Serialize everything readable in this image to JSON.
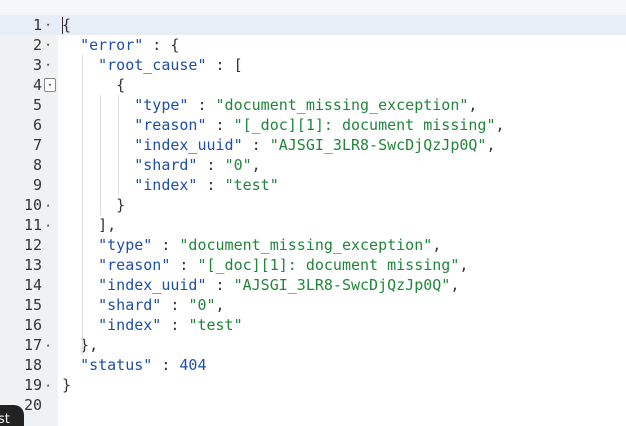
{
  "editor": {
    "lines": [
      {
        "n": "1",
        "fold": "▾",
        "t": [
          [
            "p",
            "{"
          ]
        ]
      },
      {
        "n": "2",
        "fold": "▾",
        "t": [
          [
            "p",
            "  "
          ],
          [
            "k",
            "\"error\""
          ],
          [
            "p",
            " : {"
          ]
        ]
      },
      {
        "n": "3",
        "fold": "▾",
        "t": [
          [
            "p",
            "    "
          ],
          [
            "k",
            "\"root_cause\""
          ],
          [
            "p",
            " : ["
          ]
        ]
      },
      {
        "n": "4",
        "fold": "▾",
        "boxed": true,
        "t": [
          [
            "p",
            "      {"
          ]
        ]
      },
      {
        "n": "5",
        "fold": "",
        "t": [
          [
            "p",
            "        "
          ],
          [
            "k",
            "\"type\""
          ],
          [
            "p",
            " : "
          ],
          [
            "s",
            "\"document_missing_exception\""
          ],
          [
            "p",
            ","
          ]
        ]
      },
      {
        "n": "6",
        "fold": "",
        "t": [
          [
            "p",
            "        "
          ],
          [
            "k",
            "\"reason\""
          ],
          [
            "p",
            " : "
          ],
          [
            "s",
            "\"[_doc][1]: document missing\""
          ],
          [
            "p",
            ","
          ]
        ]
      },
      {
        "n": "7",
        "fold": "",
        "t": [
          [
            "p",
            "        "
          ],
          [
            "k",
            "\"index_uuid\""
          ],
          [
            "p",
            " : "
          ],
          [
            "s",
            "\"AJSGI_3LR8-SwcDjQzJp0Q\""
          ],
          [
            "p",
            ","
          ]
        ]
      },
      {
        "n": "8",
        "fold": "",
        "t": [
          [
            "p",
            "        "
          ],
          [
            "k",
            "\"shard\""
          ],
          [
            "p",
            " : "
          ],
          [
            "s",
            "\"0\""
          ],
          [
            "p",
            ","
          ]
        ]
      },
      {
        "n": "9",
        "fold": "",
        "t": [
          [
            "p",
            "        "
          ],
          [
            "k",
            "\"index\""
          ],
          [
            "p",
            " : "
          ],
          [
            "s",
            "\"test\""
          ]
        ]
      },
      {
        "n": "10",
        "fold": "▴",
        "t": [
          [
            "p",
            "      }"
          ]
        ]
      },
      {
        "n": "11",
        "fold": "▴",
        "t": [
          [
            "p",
            "    ],"
          ]
        ]
      },
      {
        "n": "12",
        "fold": "",
        "t": [
          [
            "p",
            "    "
          ],
          [
            "k",
            "\"type\""
          ],
          [
            "p",
            " : "
          ],
          [
            "s",
            "\"document_missing_exception\""
          ],
          [
            "p",
            ","
          ]
        ]
      },
      {
        "n": "13",
        "fold": "",
        "t": [
          [
            "p",
            "    "
          ],
          [
            "k",
            "\"reason\""
          ],
          [
            "p",
            " : "
          ],
          [
            "s",
            "\"[_doc][1]: document missing\""
          ],
          [
            "p",
            ","
          ]
        ]
      },
      {
        "n": "14",
        "fold": "",
        "t": [
          [
            "p",
            "    "
          ],
          [
            "k",
            "\"index_uuid\""
          ],
          [
            "p",
            " : "
          ],
          [
            "s",
            "\"AJSGI_3LR8-SwcDjQzJp0Q\""
          ],
          [
            "p",
            ","
          ]
        ]
      },
      {
        "n": "15",
        "fold": "",
        "t": [
          [
            "p",
            "    "
          ],
          [
            "k",
            "\"shard\""
          ],
          [
            "p",
            " : "
          ],
          [
            "s",
            "\"0\""
          ],
          [
            "p",
            ","
          ]
        ]
      },
      {
        "n": "16",
        "fold": "",
        "t": [
          [
            "p",
            "    "
          ],
          [
            "k",
            "\"index\""
          ],
          [
            "p",
            " : "
          ],
          [
            "s",
            "\"test\""
          ]
        ]
      },
      {
        "n": "17",
        "fold": "▴",
        "t": [
          [
            "p",
            "  },"
          ]
        ]
      },
      {
        "n": "18",
        "fold": "",
        "t": [
          [
            "p",
            "  "
          ],
          [
            "k",
            "\"status\""
          ],
          [
            "p",
            " : "
          ],
          [
            "n",
            "404"
          ]
        ]
      },
      {
        "n": "19",
        "fold": "▴",
        "t": [
          [
            "p",
            "}"
          ]
        ]
      },
      {
        "n": "20",
        "fold": "",
        "t": []
      }
    ]
  },
  "corner_label": "st",
  "colors": {
    "key": "#1f4fa8",
    "string": "#22863a",
    "number": "#1f4fa8",
    "gutter_bg": "#f0f1f3"
  }
}
